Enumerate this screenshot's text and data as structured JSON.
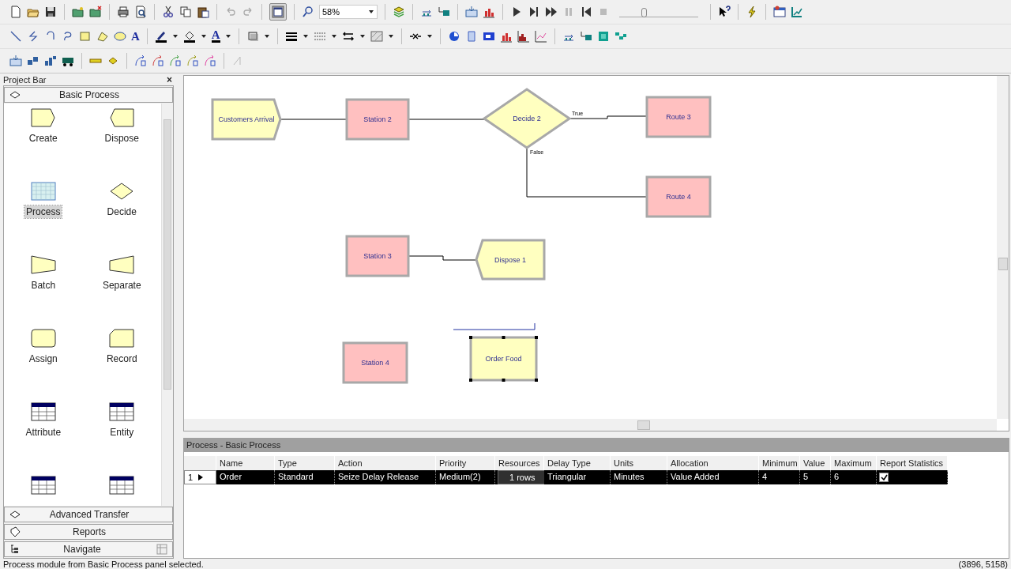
{
  "toolbar": {
    "zoom_value": "58%",
    "text_tool": "A",
    "font_color_tool": "A",
    "speed_slider": {
      "level": 0.3
    }
  },
  "project_bar": {
    "title": "Project Bar",
    "close": "×",
    "panels": [
      {
        "label": "Basic Process",
        "kind": "panel",
        "modules": [
          {
            "label": "Create",
            "kind": "create",
            "selected": false
          },
          {
            "label": "Dispose",
            "kind": "dispose",
            "selected": false
          },
          {
            "label": "Process",
            "kind": "process",
            "selected": true
          },
          {
            "label": "Decide",
            "kind": "decide",
            "selected": false
          },
          {
            "label": "Batch",
            "kind": "batch",
            "selected": false
          },
          {
            "label": "Separate",
            "kind": "separate",
            "selected": false
          },
          {
            "label": "Assign",
            "kind": "assign",
            "selected": false
          },
          {
            "label": "Record",
            "kind": "record",
            "selected": false
          },
          {
            "label": "Attribute",
            "kind": "table",
            "selected": false
          },
          {
            "label": "Entity",
            "kind": "table",
            "selected": false
          },
          {
            "kind": "table"
          },
          {
            "kind": "table"
          }
        ]
      },
      {
        "label": "Advanced Transfer",
        "kind": "panel"
      },
      {
        "label": "Reports",
        "kind": "reports"
      },
      {
        "label": "Navigate",
        "kind": "navigate"
      }
    ]
  },
  "canvas": {
    "modules": [
      {
        "label": "Customers Arrival",
        "kind": "create",
        "selected": false
      },
      {
        "label": "Station 2",
        "kind": "station",
        "selected": false
      },
      {
        "label": "Decide 2",
        "kind": "decide",
        "selected": false,
        "true_label": "True",
        "false_label": "False"
      },
      {
        "label": "Route 3",
        "kind": "station",
        "selected": false
      },
      {
        "label": "Route 4",
        "kind": "station",
        "selected": false
      },
      {
        "label": "Station 3",
        "kind": "station",
        "selected": false
      },
      {
        "label": "Dispose 1",
        "kind": "dispose",
        "selected": false
      },
      {
        "label": "Station 4",
        "kind": "station",
        "selected": false
      },
      {
        "label": "Order Food",
        "kind": "process",
        "selected": true
      }
    ]
  },
  "spreadsheet": {
    "title": "Process - Basic Process",
    "columns": [
      "Name",
      "Type",
      "Action",
      "Priority",
      "Resources",
      "Delay Type",
      "Units",
      "Allocation",
      "Minimum",
      "Value",
      "Maximum",
      "Report Statistics"
    ],
    "rows": [
      {
        "number": "1",
        "selected": true,
        "cells": [
          {
            "kind": "text",
            "text": "Order"
          },
          {
            "kind": "text",
            "text": "Standard"
          },
          {
            "kind": "text",
            "text": "Seize Delay Release"
          },
          {
            "kind": "text",
            "text": "Medium(2)"
          },
          {
            "kind": "button",
            "text": "1 rows"
          },
          {
            "kind": "text",
            "text": "Triangular"
          },
          {
            "kind": "text",
            "text": "Minutes"
          },
          {
            "kind": "text",
            "text": "Value Added"
          },
          {
            "kind": "text",
            "text": "4"
          },
          {
            "kind": "text",
            "text": "5"
          },
          {
            "kind": "text",
            "text": "6"
          },
          {
            "kind": "checkbox",
            "checked": true
          }
        ]
      }
    ]
  },
  "status_bar": {
    "message": "Process module from Basic Process panel selected.",
    "coordinates": "(3896, 5158)"
  }
}
